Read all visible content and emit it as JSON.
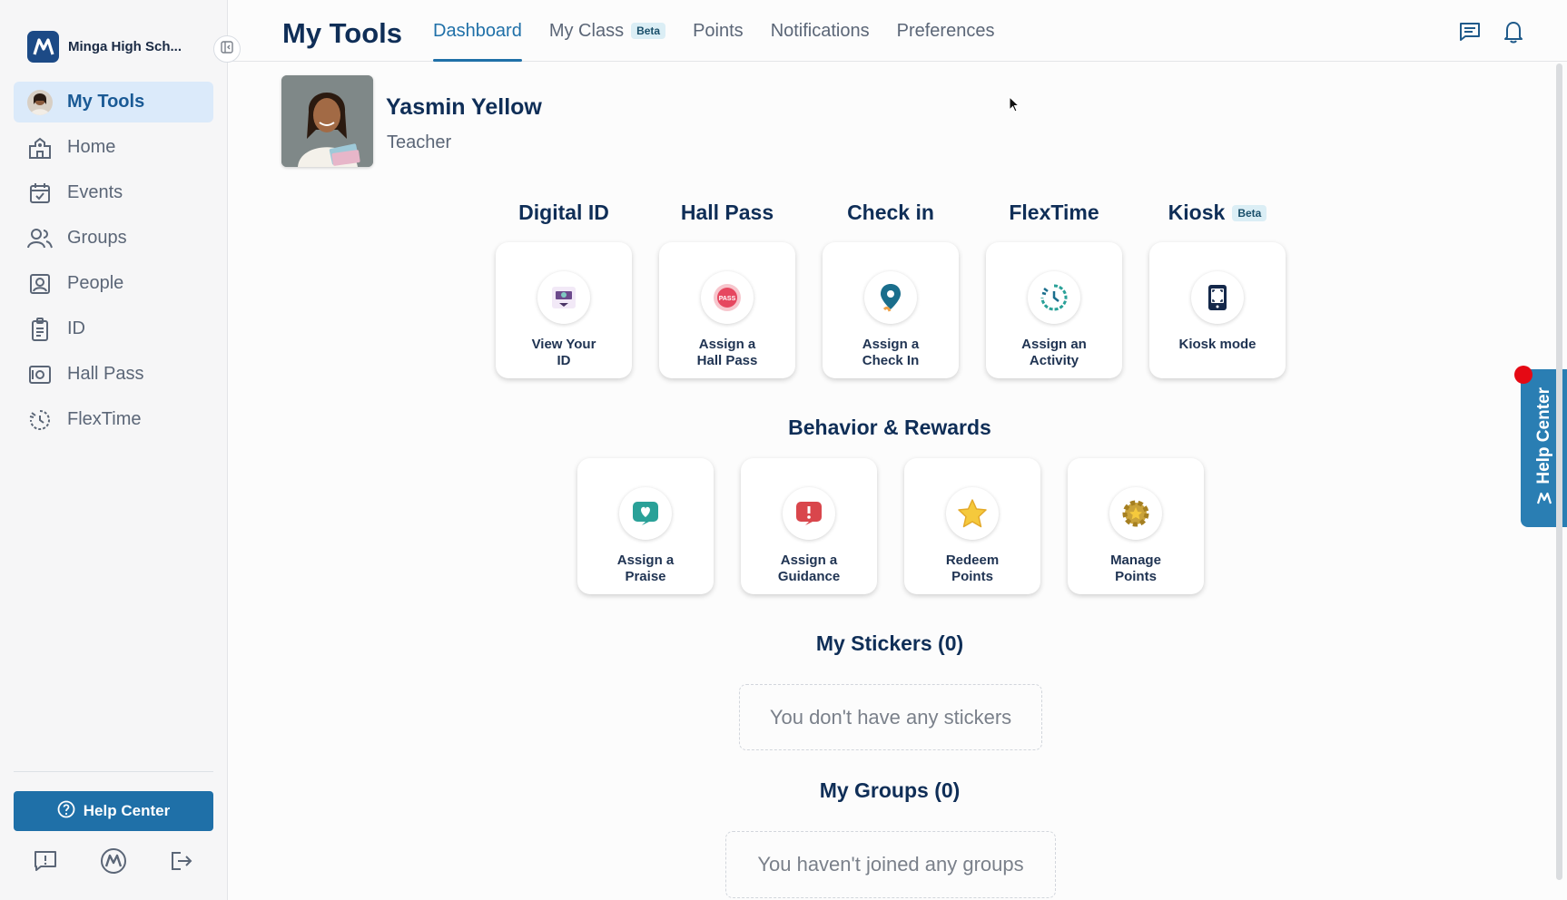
{
  "sidebar": {
    "school_name": "Minga High Sch...",
    "items": [
      {
        "label": "My Tools",
        "icon": "avatar"
      },
      {
        "label": "Home",
        "icon": "school-icon"
      },
      {
        "label": "Events",
        "icon": "calendar-icon"
      },
      {
        "label": "Groups",
        "icon": "groups-icon"
      },
      {
        "label": "People",
        "icon": "person-card-icon"
      },
      {
        "label": "ID",
        "icon": "id-badge-icon"
      },
      {
        "label": "Hall Pass",
        "icon": "hall-pass-icon"
      },
      {
        "label": "FlexTime",
        "icon": "flextime-icon"
      }
    ],
    "help_center_label": "Help Center"
  },
  "header": {
    "title": "My Tools",
    "tabs": [
      {
        "label": "Dashboard",
        "active": true
      },
      {
        "label": "My Class",
        "badge": "Beta"
      },
      {
        "label": "Points"
      },
      {
        "label": "Notifications"
      },
      {
        "label": "Preferences"
      }
    ]
  },
  "profile": {
    "name": "Yasmin Yellow",
    "role": "Teacher"
  },
  "tools": {
    "headings": [
      "Digital ID",
      "Hall Pass",
      "Check in",
      "FlexTime",
      "Kiosk"
    ],
    "kiosk_badge": "Beta",
    "cards": [
      {
        "label": "View Your\nID",
        "icon": "digital-id-icon"
      },
      {
        "label": "Assign a\nHall Pass",
        "icon": "hall-pass-badge-icon",
        "icon_text": "PASS"
      },
      {
        "label": "Assign a\nCheck In",
        "icon": "location-pin-icon"
      },
      {
        "label": "Assign an\nActivity",
        "icon": "activity-icon"
      },
      {
        "label": "Kiosk mode",
        "icon": "kiosk-icon"
      }
    ]
  },
  "behavior": {
    "heading": "Behavior & Rewards",
    "cards": [
      {
        "label": "Assign a\nPraise",
        "icon": "praise-heart-icon"
      },
      {
        "label": "Assign a\nGuidance",
        "icon": "guidance-alert-icon"
      },
      {
        "label": "Redeem\nPoints",
        "icon": "star-icon"
      },
      {
        "label": "Manage\nPoints",
        "icon": "gear-badge-icon"
      }
    ]
  },
  "stickers": {
    "heading": "My Stickers (0)",
    "empty_text": "You don't have any stickers"
  },
  "groups": {
    "heading": "My Groups (0)",
    "empty_text": "You haven't joined any groups"
  },
  "help_tab": {
    "label": "Help Center"
  },
  "colors": {
    "accent": "#1f70a8",
    "heading": "#0f2e57",
    "active_nav_bg": "#dbeafa",
    "notification_dot": "#e50914"
  }
}
